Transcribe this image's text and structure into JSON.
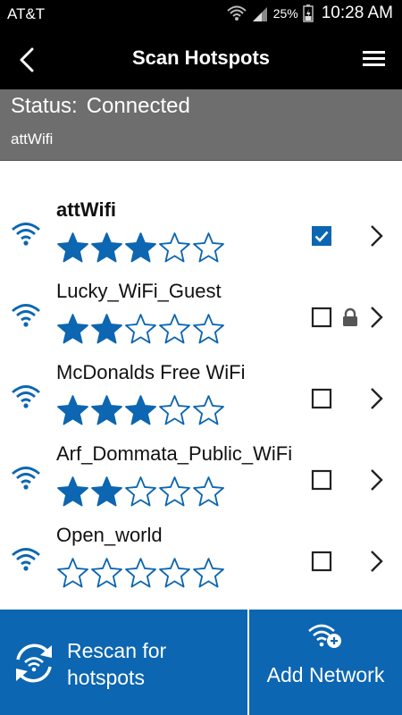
{
  "status_bar": {
    "carrier": "AT&T",
    "battery_percent": "25%",
    "time": "10:28 AM"
  },
  "app_bar": {
    "title": "Scan Hotspots",
    "back_icon": "back-arrow-icon",
    "menu_icon": "hamburger-menu-icon"
  },
  "connection": {
    "status_label": "Status:",
    "status_value": "Connected",
    "ssid": "attWifi"
  },
  "networks": [
    {
      "name": "attWifi",
      "rating": 3,
      "max_rating": 5,
      "selected": true,
      "locked": false,
      "bold": true
    },
    {
      "name": "Lucky_WiFi_Guest",
      "rating": 2,
      "max_rating": 5,
      "selected": false,
      "locked": true,
      "bold": false
    },
    {
      "name": "McDonalds Free WiFi",
      "rating": 3,
      "max_rating": 5,
      "selected": false,
      "locked": false,
      "bold": false
    },
    {
      "name": "Arf_Dommata_Public_WiFi",
      "rating": 2,
      "max_rating": 5,
      "selected": false,
      "locked": false,
      "bold": false
    },
    {
      "name": "Open_world",
      "rating": 0,
      "max_rating": 5,
      "selected": false,
      "locked": false,
      "bold": false
    }
  ],
  "actions": {
    "rescan_label": "Rescan for hotspots",
    "add_network_label": "Add Network"
  },
  "colors": {
    "accent": "#0c66b1",
    "star_fill": "#0c66b1",
    "status_panel": "#6e6e6e",
    "header": "#000000"
  }
}
